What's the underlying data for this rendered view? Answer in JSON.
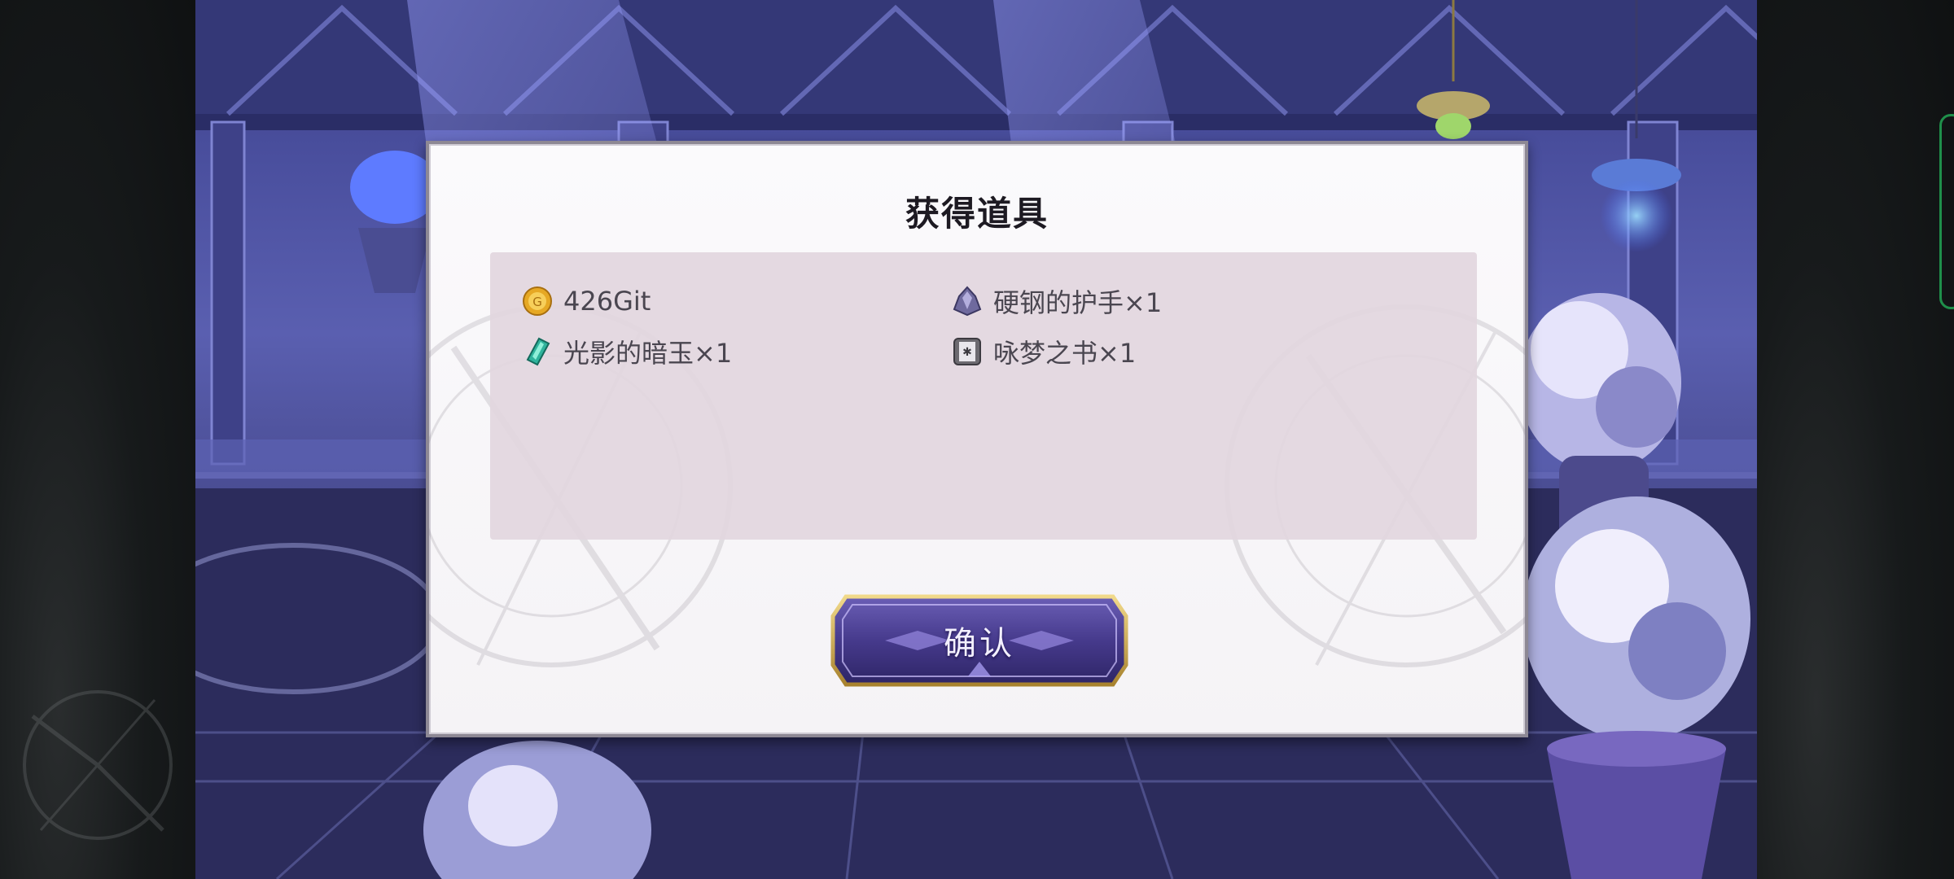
{
  "dialog": {
    "title": "获得道具",
    "items": [
      {
        "icon": "gold-coin-icon",
        "label": "426Git"
      },
      {
        "icon": "crystal-gauntlet-icon",
        "label": "硬钢的护手×1"
      },
      {
        "icon": "green-gem-icon",
        "label": "光影的暗玉×1"
      },
      {
        "icon": "book-icon",
        "label": "咏梦之书×1"
      }
    ],
    "confirm_label": "确认"
  },
  "colors": {
    "scene_accent": "#4a4f9e",
    "dialog_bg": "#f8f6f9",
    "panel_bg": "#e2d6de",
    "button_gold": "#c9a24a",
    "button_purple": "#4b3c8a"
  }
}
